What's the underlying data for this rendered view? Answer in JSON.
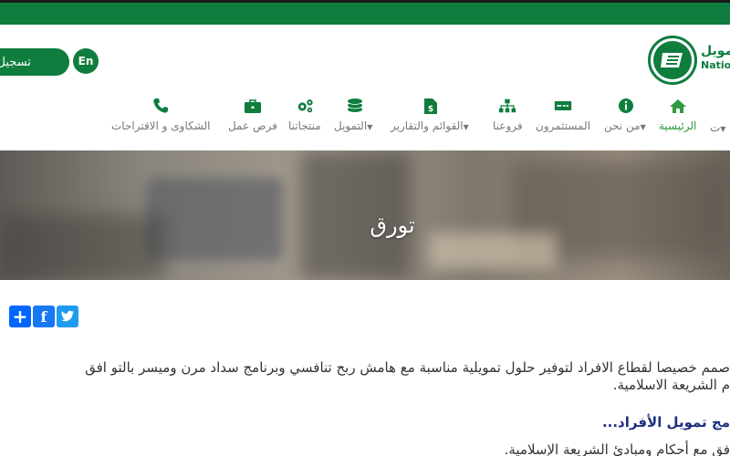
{
  "colors": {
    "brand": "#0f7d3e",
    "active_nav": "#2e9a3e",
    "heading": "#1b2f80"
  },
  "header": {
    "login_label": "تسجيل الد",
    "lang_label": "En",
    "logo_ar": "تمويل",
    "logo_en": "Nation"
  },
  "nav": [
    {
      "label": "الرئيسية",
      "icon": "home-icon",
      "active": true
    },
    {
      "label": "من نحن",
      "icon": "info-icon",
      "dropdown": true
    },
    {
      "label": "المستثمرون",
      "icon": "money-icon"
    },
    {
      "label": "فروعنا",
      "icon": "sitemap-icon"
    },
    {
      "label": "القوائم والتقارير",
      "icon": "document-dollar-icon",
      "dropdown": true
    },
    {
      "label": "التمويل",
      "icon": "coins-icon",
      "dropdown": true
    },
    {
      "label": "منتجاتنا",
      "icon": "gears-icon"
    },
    {
      "label": "فرص عمل",
      "icon": "briefcase-icon"
    },
    {
      "label": "الشكاوى و الاقتراحات",
      "icon": "phone-icon"
    }
  ],
  "nav_partial": "ت",
  "hero": {
    "title": "تورق"
  },
  "share": {
    "icons": [
      "addtoany-icon",
      "facebook-icon",
      "twitter-icon"
    ]
  },
  "content": {
    "line1": "صمم خصيصا لقطاع الافراد لتوفير حلول تمويلية مناسبة مع هامش ربح تنافسي وبرنامج سداد مرن وميسر بالتو افق",
    "line2": "م الشريعة الاسلامية.",
    "subheading": "مج تمويل الأفراد...",
    "line3": "فق مع أحكام ومبادئ الشريعة الإسلامية."
  }
}
